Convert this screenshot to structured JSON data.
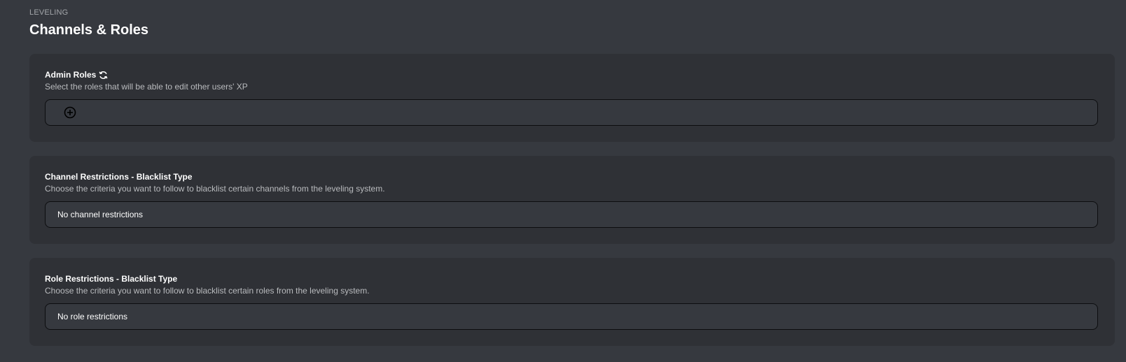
{
  "header": {
    "eyebrow": "LEVELING",
    "title": "Channels & Roles"
  },
  "admin_roles": {
    "title": "Admin Roles",
    "description": "Select the roles that will be able to edit other users' XP",
    "icons": [
      "refresh-icon",
      "add-circle-icon"
    ]
  },
  "channel_restrictions": {
    "title": "Channel Restrictions - Blacklist Type",
    "description": "Choose the criteria you want to follow to blacklist certain channels from the leveling system.",
    "selected_value": "No channel restrictions"
  },
  "role_restrictions": {
    "title": "Role Restrictions - Blacklist Type",
    "description": "Choose the criteria you want to follow to blacklist certain roles from the leveling system.",
    "selected_value": "No role restrictions"
  },
  "colors": {
    "page_background": "#36393f",
    "card_background": "#2f3136",
    "field_border": "#0c0d0f",
    "muted_text": "#b9bbbe"
  }
}
